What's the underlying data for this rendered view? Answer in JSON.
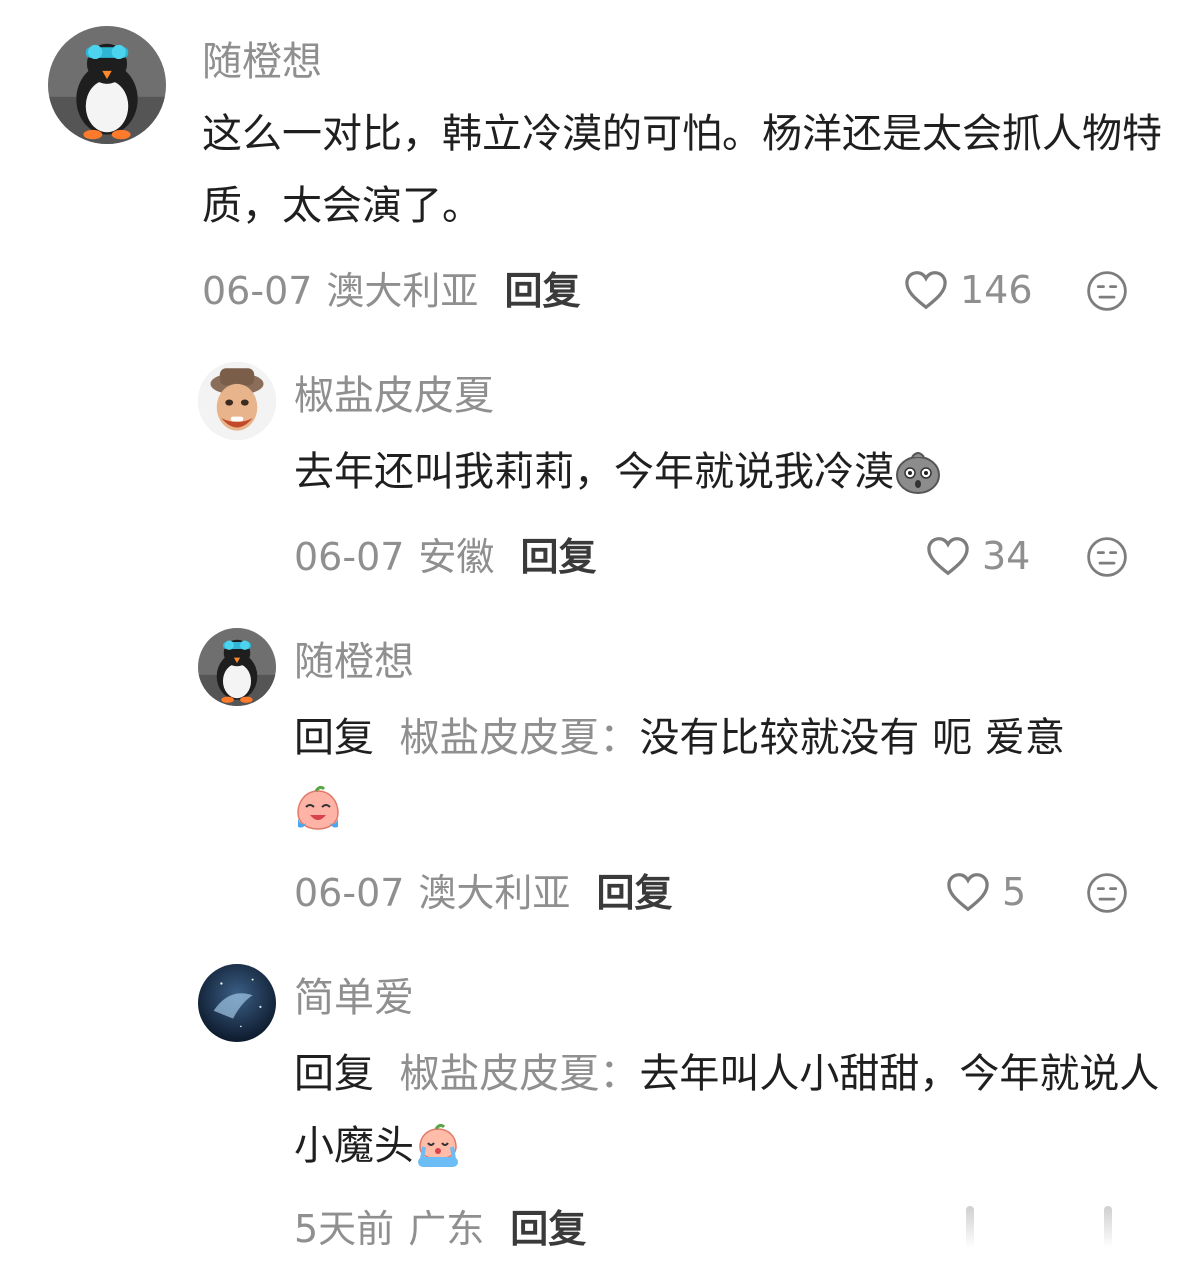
{
  "comments": [
    {
      "user": "随橙想",
      "text": "这么一对比，韩立冷漠的可怕。杨洋还是太会抓人物特质，太会演了。",
      "date": "06-07",
      "location": "澳大利亚",
      "reply_label": "回复",
      "likes": "146"
    },
    {
      "user": "椒盐皮皮夏",
      "text": "去年还叫我莉莉，今年就说我冷漠",
      "date": "06-07",
      "location": "安徽",
      "reply_label": "回复",
      "likes": "34"
    },
    {
      "user": "随橙想",
      "reply_prefix": "回复",
      "reply_to": "椒盐皮皮夏：",
      "text": "没有比较就没有 呃 爱意",
      "date": "06-07",
      "location": "澳大利亚",
      "reply_label": "回复",
      "likes": "5"
    },
    {
      "user": "简单爱",
      "reply_prefix": "回复",
      "reply_to": "椒盐皮皮夏：",
      "text": "去年叫人小甜甜，今年就说人小魔头",
      "date": "5天前",
      "location": "广东",
      "reply_label": "回复"
    }
  ],
  "icons": {
    "like": "heart-outline-icon",
    "dislike": "meh-face-icon",
    "emoji_1": "gray-shocked-emoji",
    "emoji_2": "crying-laughing-peach-emoji",
    "emoji_3": "crying-peach-emoji"
  },
  "colors": {
    "username": "#8f8f8f",
    "text": "#1f1f1f",
    "meta": "#8f8f8f"
  }
}
